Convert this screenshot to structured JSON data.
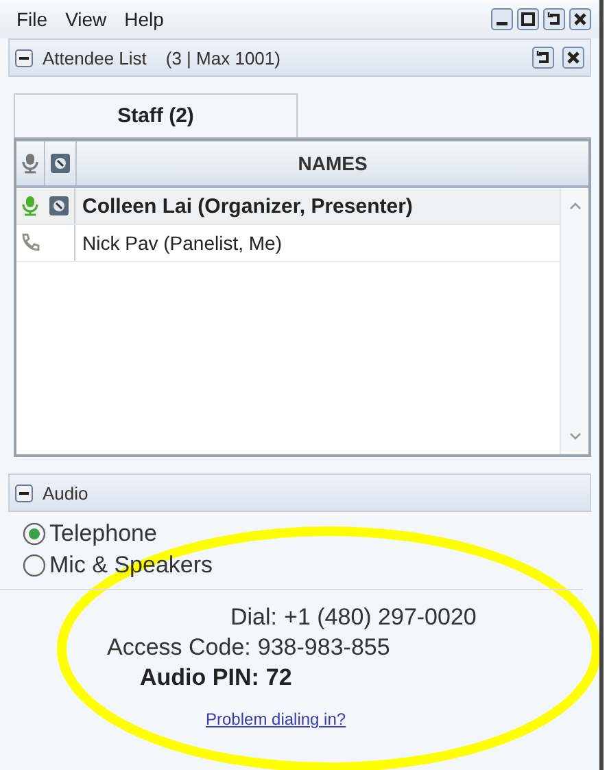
{
  "menu": [
    "File",
    "View",
    "Help"
  ],
  "attendee_panel": {
    "title": "Attendee List",
    "count": "(3 | Max 1001)"
  },
  "tabs": [
    {
      "label": "Staff (2)",
      "selected": true
    }
  ],
  "table": {
    "columns": [
      {
        "header": "NAMES"
      }
    ],
    "rows": [
      {
        "name": "Colleen Lai (Organizer, Presenter)",
        "kind": "microphone",
        "presenter": true,
        "selected": true
      },
      {
        "name": "Nick Pav (Panelist, Me)",
        "kind": "telephone",
        "presenter": false,
        "selected": false
      }
    ]
  },
  "audio": {
    "title": "Audio",
    "options": [
      {
        "label": "Telephone",
        "selected": true
      },
      {
        "label": "Mic & Speakers",
        "selected": false
      }
    ],
    "details": [
      {
        "kind": "dial",
        "label": "Dial:",
        "value": "+1 (480) 297-0020"
      },
      {
        "kind": "access",
        "label": "Access Code:",
        "value": "938-983-855"
      },
      {
        "kind": "pin",
        "label": "Audio PIN:",
        "value": "72"
      }
    ],
    "link": "Problem dialing in?"
  }
}
